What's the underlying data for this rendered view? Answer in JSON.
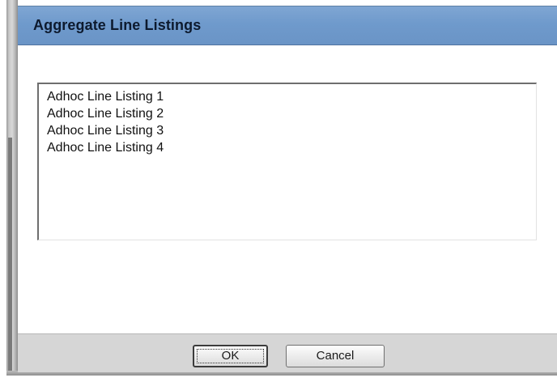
{
  "dialog": {
    "title": "Aggregate Line Listings"
  },
  "listbox": {
    "items": [
      {
        "label": "Adhoc Line Listing 1"
      },
      {
        "label": "Adhoc Line Listing 2"
      },
      {
        "label": "Adhoc Line Listing 3"
      },
      {
        "label": "Adhoc Line Listing 4"
      }
    ]
  },
  "buttons": {
    "ok_label": "OK",
    "cancel_label": "Cancel"
  },
  "colors": {
    "title_bar": "#6f9acc",
    "button_bar": "#d6d6d6"
  }
}
